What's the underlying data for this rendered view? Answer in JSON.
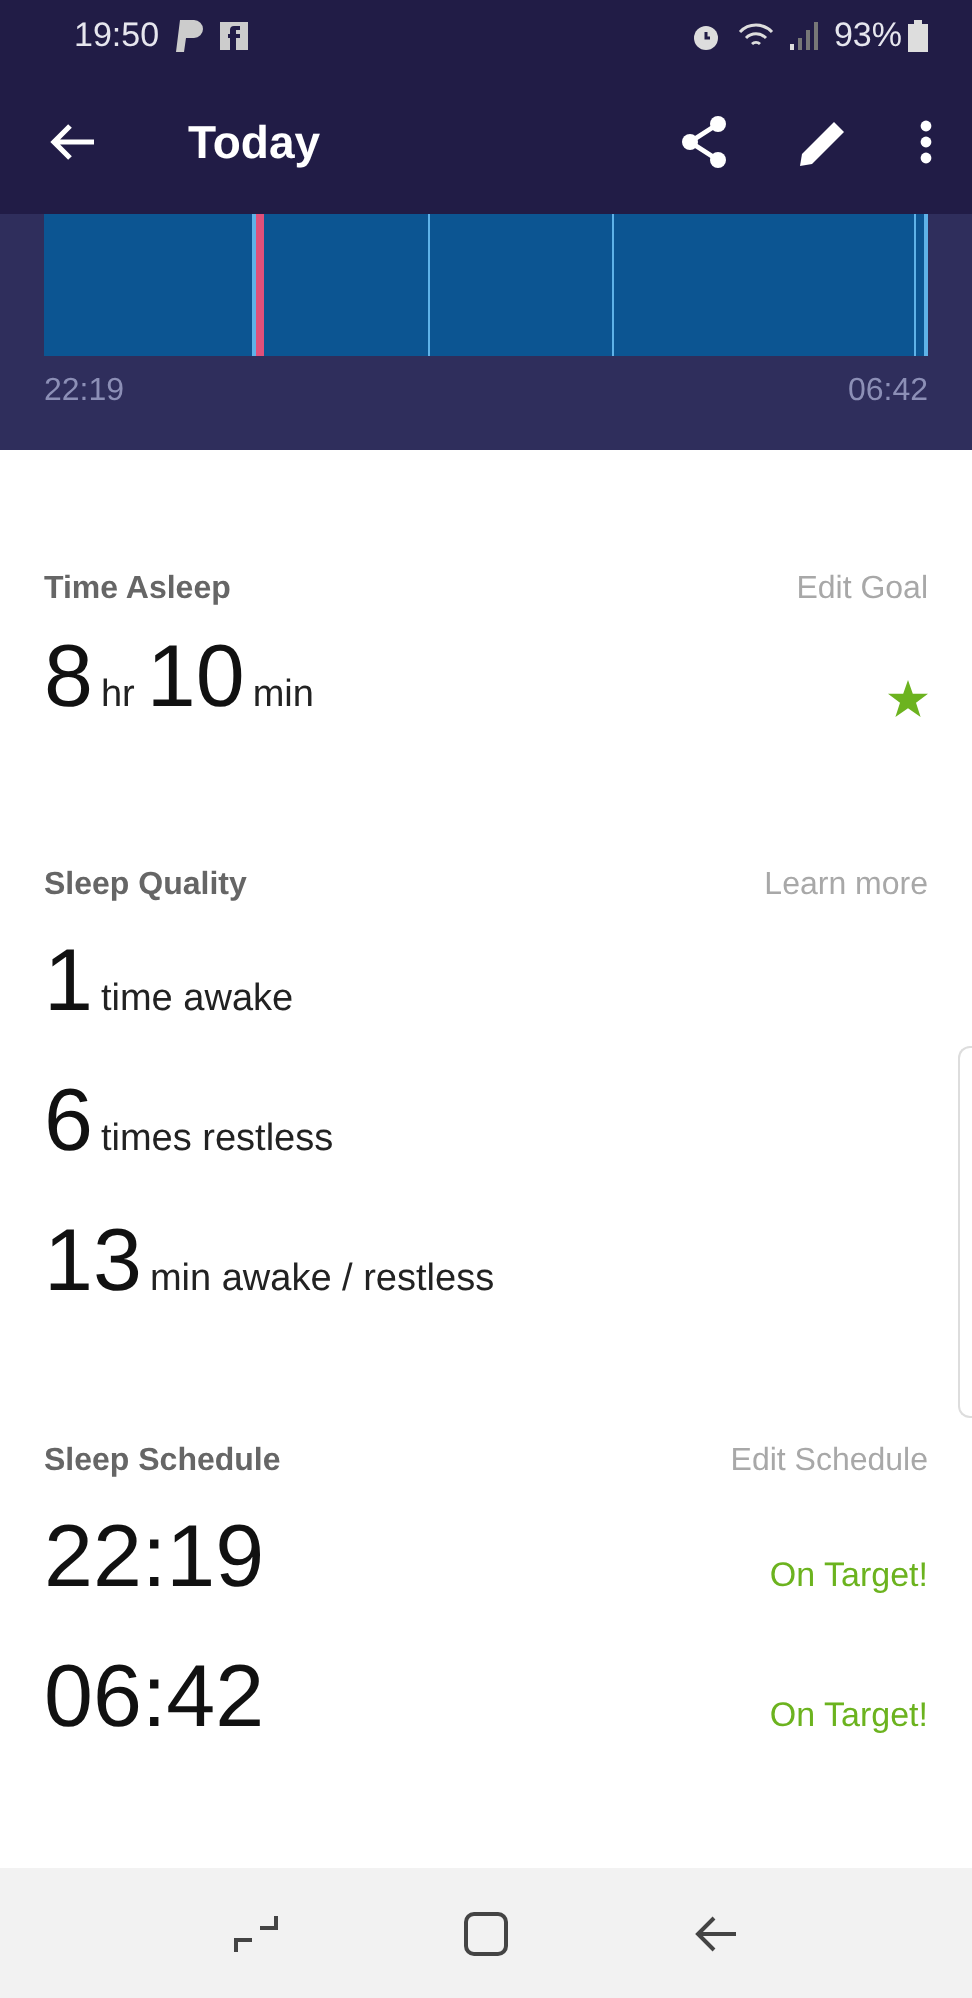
{
  "status_bar": {
    "time": "19:50",
    "battery": "93%"
  },
  "app_bar": {
    "title": "Today"
  },
  "sleep_chart": {
    "start": "22:19",
    "end": "06:42"
  },
  "time_asleep": {
    "title": "Time Asleep",
    "action": "Edit Goal",
    "hours": "8",
    "hours_unit": "hr",
    "minutes": "10",
    "minutes_unit": "min",
    "goal_met": true
  },
  "sleep_quality": {
    "title": "Sleep Quality",
    "action": "Learn more",
    "items": [
      {
        "value": "1",
        "label": "time awake"
      },
      {
        "value": "6",
        "label": "times restless"
      },
      {
        "value": "13",
        "label": "min awake / restless"
      }
    ]
  },
  "sleep_schedule": {
    "title": "Sleep Schedule",
    "action": "Edit Schedule",
    "items": [
      {
        "time": "22:19",
        "status": "On Target!"
      },
      {
        "time": "06:42",
        "status": "On Target!"
      }
    ]
  }
}
